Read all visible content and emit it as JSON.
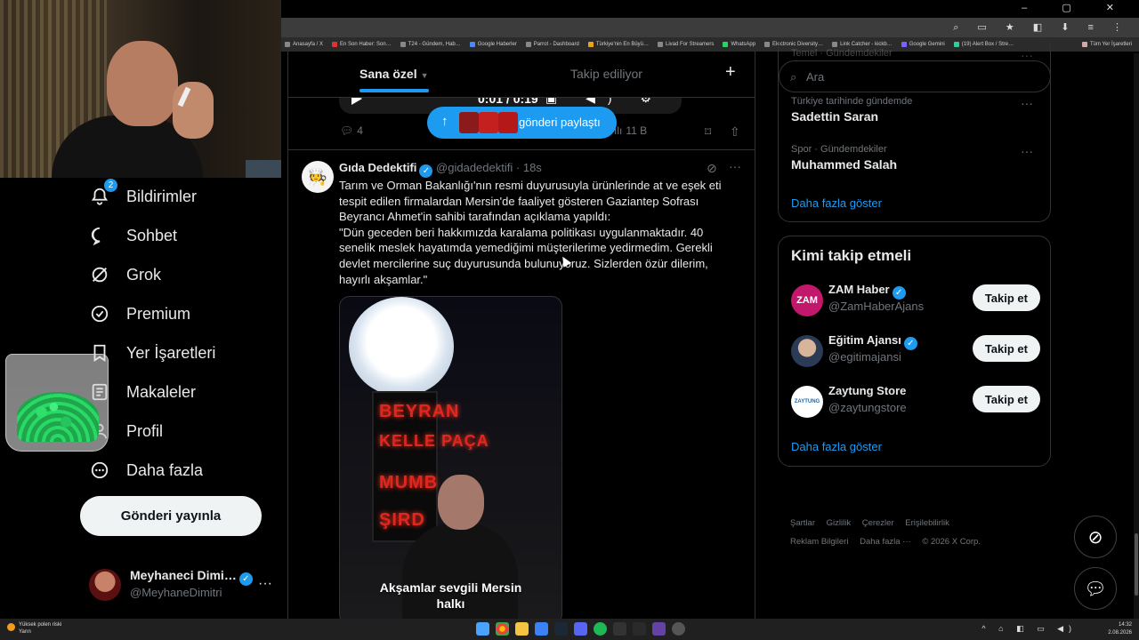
{
  "nav": {
    "items": [
      {
        "label": "Bildirimler",
        "icon": "bell-icon",
        "badge": "2"
      },
      {
        "label": "Sohbet",
        "icon": "chat-bubble-icon"
      },
      {
        "label": "Grok",
        "icon": "grok-icon"
      },
      {
        "label": "Premium",
        "icon": "premium-badge-icon"
      },
      {
        "label": "Yer İşaretleri",
        "icon": "bookmark-icon"
      },
      {
        "label": "Makaleler",
        "icon": "article-icon"
      },
      {
        "label": "Profil",
        "icon": "person-icon"
      },
      {
        "label": "Daha fazla",
        "icon": "more-circle-icon"
      }
    ],
    "post_button": "Gönderi yayınla",
    "profile": {
      "name": "Meyhaneci Dimi…",
      "handle": "@MeyhaneDimitri"
    }
  },
  "bookmarks_bar": {
    "items": [
      "Anasayfa / X",
      "En Son Haber: Son…",
      "T24 - Gündem, Hab…",
      "Google Haberler",
      "Parrot - Dashboard",
      "Türkiye'nin En Büyü…",
      "Livad For Streamers",
      "WhatsApp",
      "Electronic Diversity…",
      "Link Catcher - kickb…",
      "Google Gemini",
      "(19) Alert Box / Stre…"
    ],
    "all_bookmarks": "Tüm Yer İşaretleri"
  },
  "timeline": {
    "tabs": [
      {
        "label": "Sana özel",
        "active": true
      },
      {
        "label": "Takip ediliyor",
        "active": false
      }
    ],
    "video": {
      "time": "0:01 / 0:19"
    },
    "toast": {
      "text": "gönderi paylaştı"
    },
    "prev_tweet_actions": {
      "replies": "4",
      "views": "11 B"
    },
    "tweet": {
      "name": "Gıda Dedektifi",
      "handle": "@gidadedektifi",
      "time": "18s",
      "paragraph1": "Tarım ve Orman Bakanlığı'nın resmi duyurusuyla ürünlerinde at ve eşek eti tespit edilen firmalardan Mersin'de faaliyet gösteren Gaziantep Sofrası Beyrancı Ahmet'in sahibi tarafından açıklama yapıldı:",
      "paragraph2": "\"Dün geceden beri hakkımızda karalama politikası uygulanmaktadır. 40 senelik meslek hayatımda yemediğimi müşterilerime yedirmedim. Gerekli devlet mercilerine suç duyurusunda bulunuyoruz. Sizlerden özür dilerim, hayırlı akşamlar.\"",
      "media_sign_lines": [
        "BEYRAN",
        "KELLE PAÇA",
        "MUMB",
        "ŞIRD"
      ],
      "media_caption_line1": "Akşamlar sevgili Mersin",
      "media_caption_line2": "halkı"
    }
  },
  "right": {
    "search_placeholder": "Ara",
    "trends_partial": "Temel · Gündemdekiler",
    "trends": [
      {
        "context": "Türkiye tarihinde gündemde",
        "title": "Sadettin Saran"
      },
      {
        "context": "Spor · Gündemdekiler",
        "title": "Muhammed Salah"
      }
    ],
    "trends_show_more": "Daha fazla göster",
    "who_to_follow": {
      "title": "Kimi takip etmeli",
      "accounts": [
        {
          "name": "ZAM Haber",
          "handle": "@ZamHaberAjans",
          "button": "Takip et",
          "avatar_text": "ZAM"
        },
        {
          "name": "Eğitim Ajansı",
          "handle": "@egitimajansi",
          "button": "Takip et",
          "avatar_text": ""
        },
        {
          "name": "Zaytung Store",
          "handle": "@zaytungstore",
          "button": "Takip et",
          "avatar_text": "ZAYTUNG"
        }
      ],
      "show_more": "Daha fazla göster"
    },
    "footer": [
      "Şartlar",
      "Gizlilik",
      "Çerezler",
      "Erişilebilirlik",
      "Reklam Bilgileri",
      "Daha fazla ···",
      "© 2026 X Corp."
    ]
  },
  "taskbar": {
    "weather_line1": "Yüksek polen riski",
    "weather_line2": "Yarın",
    "time": "14:32",
    "date": "2.08.2026"
  },
  "colors": {
    "accent": "#1d9bf0",
    "background": "#000000",
    "text": "#e7e9ea",
    "muted": "#71767b",
    "border": "#2f3336"
  }
}
